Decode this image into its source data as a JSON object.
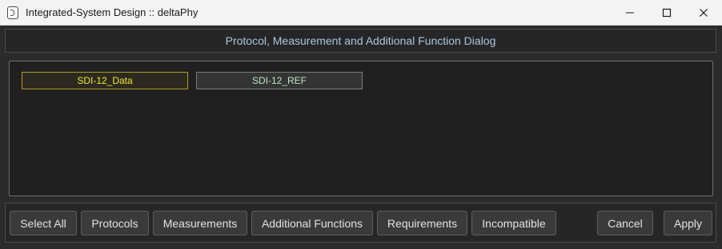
{
  "window": {
    "title": "Integrated-System Design :: deltaPhy",
    "app_icon": "deltaphy-app-icon",
    "controls": [
      "minimize-icon",
      "maximize-icon",
      "close-icon"
    ]
  },
  "dialog": {
    "header": "Protocol, Measurement and Additional Function Dialog"
  },
  "items": [
    {
      "label": "SDI-12_Data",
      "state": "selected",
      "color": "#f2ea2a"
    },
    {
      "label": "SDI-12_REF",
      "state": "normal",
      "color": "#bde6c2"
    }
  ],
  "buttons": {
    "select_all": "Select All",
    "protocols": "Protocols",
    "measurements": "Measurements",
    "additional_functions": "Additional Functions",
    "requirements": "Requirements",
    "incompatible": "Incompatible",
    "cancel": "Cancel",
    "apply": "Apply"
  },
  "colors": {
    "header_text": "#a9c8dd",
    "background": "#2b2b2b"
  }
}
